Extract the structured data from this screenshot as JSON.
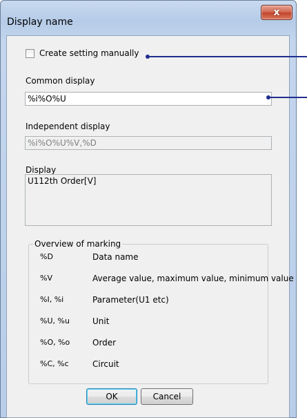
{
  "window": {
    "title": "Display name",
    "close_symbol": "x"
  },
  "manual_checkbox": {
    "label": "Create setting manually",
    "checked": false
  },
  "common_display": {
    "label": "Common display",
    "value": "%i%O%U"
  },
  "independent_display": {
    "label": "Independent display",
    "value": "%i%O%U%V,%D"
  },
  "display": {
    "label": "Display",
    "value": "U112th Order[V]"
  },
  "marking": {
    "title": "Overview of marking",
    "items": [
      {
        "code": "%D",
        "desc": "Data name"
      },
      {
        "code": "%V",
        "desc": "Average value, maximum value, minimum value"
      },
      {
        "code": "%I, %i",
        "desc": "Parameter(U1 etc)"
      },
      {
        "code": "%U, %u",
        "desc": "Unit"
      },
      {
        "code": "%O, %o",
        "desc": "Order"
      },
      {
        "code": "%C, %c",
        "desc": "Circuit"
      }
    ]
  },
  "buttons": {
    "ok": "OK",
    "cancel": "Cancel"
  },
  "callout_color": "#1f2d8f"
}
